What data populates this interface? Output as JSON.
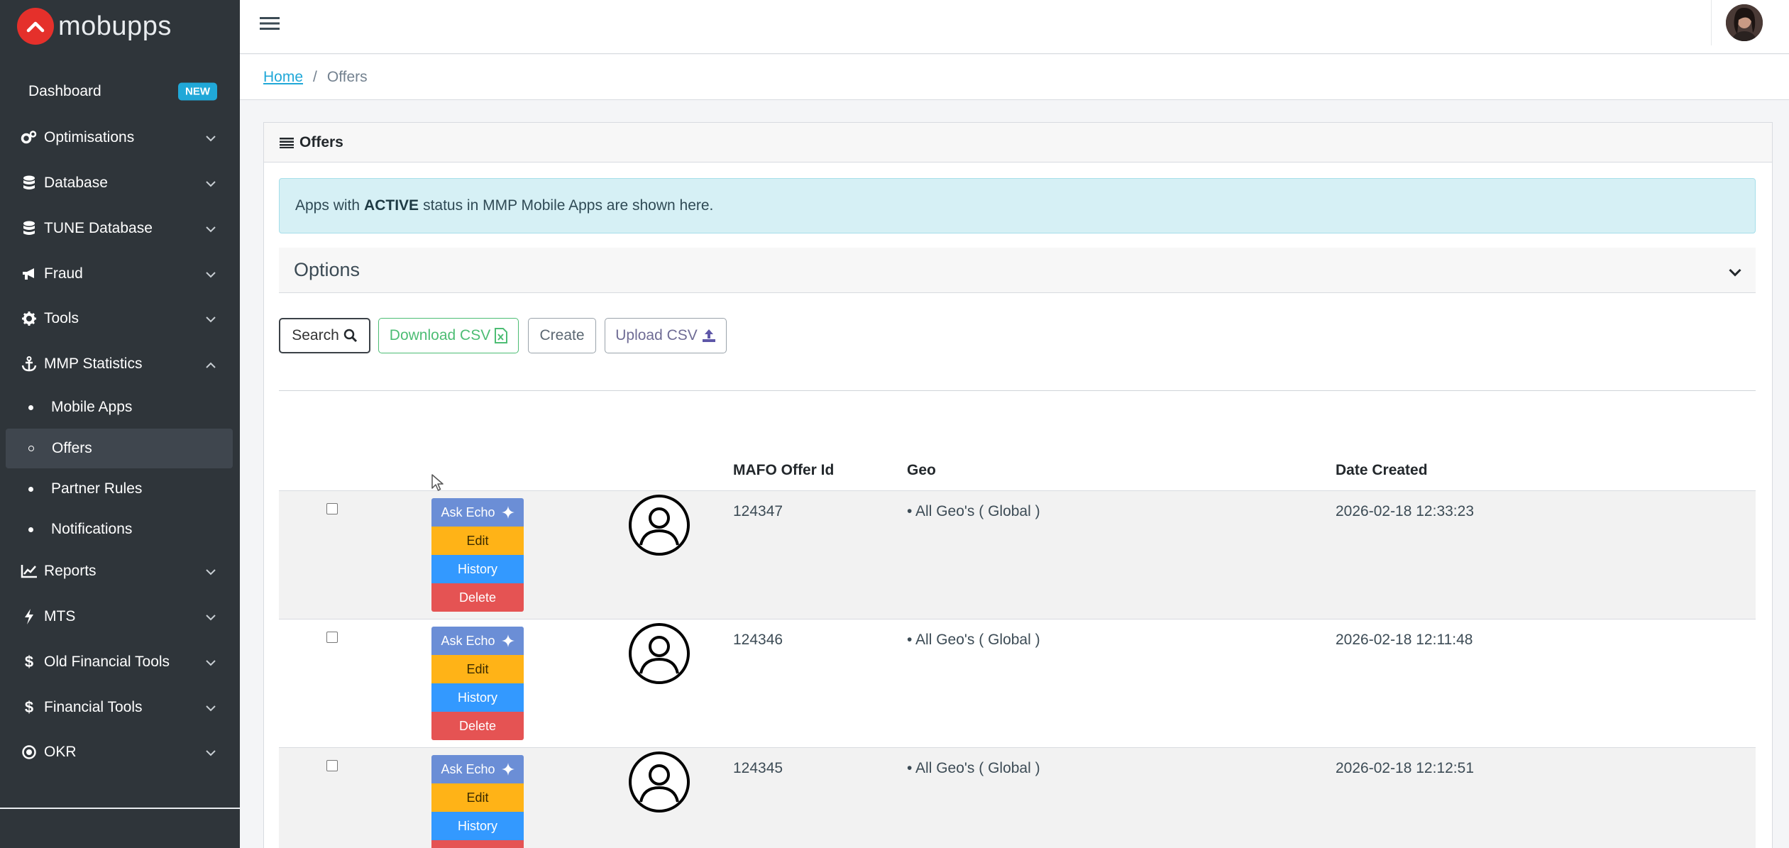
{
  "brand": {
    "name": "mobupps"
  },
  "sidebar": {
    "dashboard": {
      "label": "Dashboard",
      "badge": "NEW"
    },
    "items": [
      {
        "label": "Optimisations",
        "icon": "cogs-icon"
      },
      {
        "label": "Database",
        "icon": "database-icon"
      },
      {
        "label": "TUNE Database",
        "icon": "database-icon"
      },
      {
        "label": "Fraud",
        "icon": "megaphone-icon"
      },
      {
        "label": "Tools",
        "icon": "gear-icon"
      },
      {
        "label": "MMP Statistics",
        "icon": "anchor-icon",
        "expanded": true
      },
      {
        "label": "Reports",
        "icon": "line-chart-icon"
      },
      {
        "label": "MTS",
        "icon": "bolt-icon"
      },
      {
        "label": "Old Financial Tools",
        "icon": "dollar-icon"
      },
      {
        "label": "Financial Tools",
        "icon": "dollar-icon"
      },
      {
        "label": "OKR",
        "icon": "target-icon"
      }
    ],
    "mmp_children": [
      {
        "label": "Mobile Apps"
      },
      {
        "label": "Offers",
        "active": true
      },
      {
        "label": "Partner Rules"
      },
      {
        "label": "Notifications"
      }
    ]
  },
  "breadcrumb": {
    "home": "Home",
    "separator": "/",
    "current": "Offers"
  },
  "card": {
    "title": "Offers",
    "alert": {
      "before": "Apps with",
      "bold": "ACTIVE",
      "after": "status in MMP Mobile Apps are shown here."
    },
    "options_label": "Options",
    "buttons": {
      "search": "Search",
      "download": "Download CSV",
      "create": "Create",
      "upload": "Upload CSV"
    }
  },
  "table": {
    "columns": {
      "offer_id": "MAFO Offer Id",
      "geo": "Geo",
      "date": "Date Created"
    },
    "actions": {
      "ask": "Ask Echo",
      "edit": "Edit",
      "history": "History",
      "delete": "Delete"
    },
    "rows": [
      {
        "offer_id": "124347",
        "geo": "• All Geo's ( Global )",
        "date": "2026-02-18 12:33:23"
      },
      {
        "offer_id": "124346",
        "geo": "• All Geo's ( Global )",
        "date": "2026-02-18 12:11:48"
      },
      {
        "offer_id": "124345",
        "geo": "• All Geo's ( Global )",
        "date": "2026-02-18 12:12:51"
      }
    ]
  },
  "colors": {
    "sidebar_bg": "#2f353a",
    "brand_red": "#e5302b",
    "info_badge": "#20a8d8",
    "ask_echo": "#6b8ed6",
    "edit": "#ffb317",
    "history": "#3399ff",
    "delete": "#e55353",
    "success": "#4dbd74"
  }
}
